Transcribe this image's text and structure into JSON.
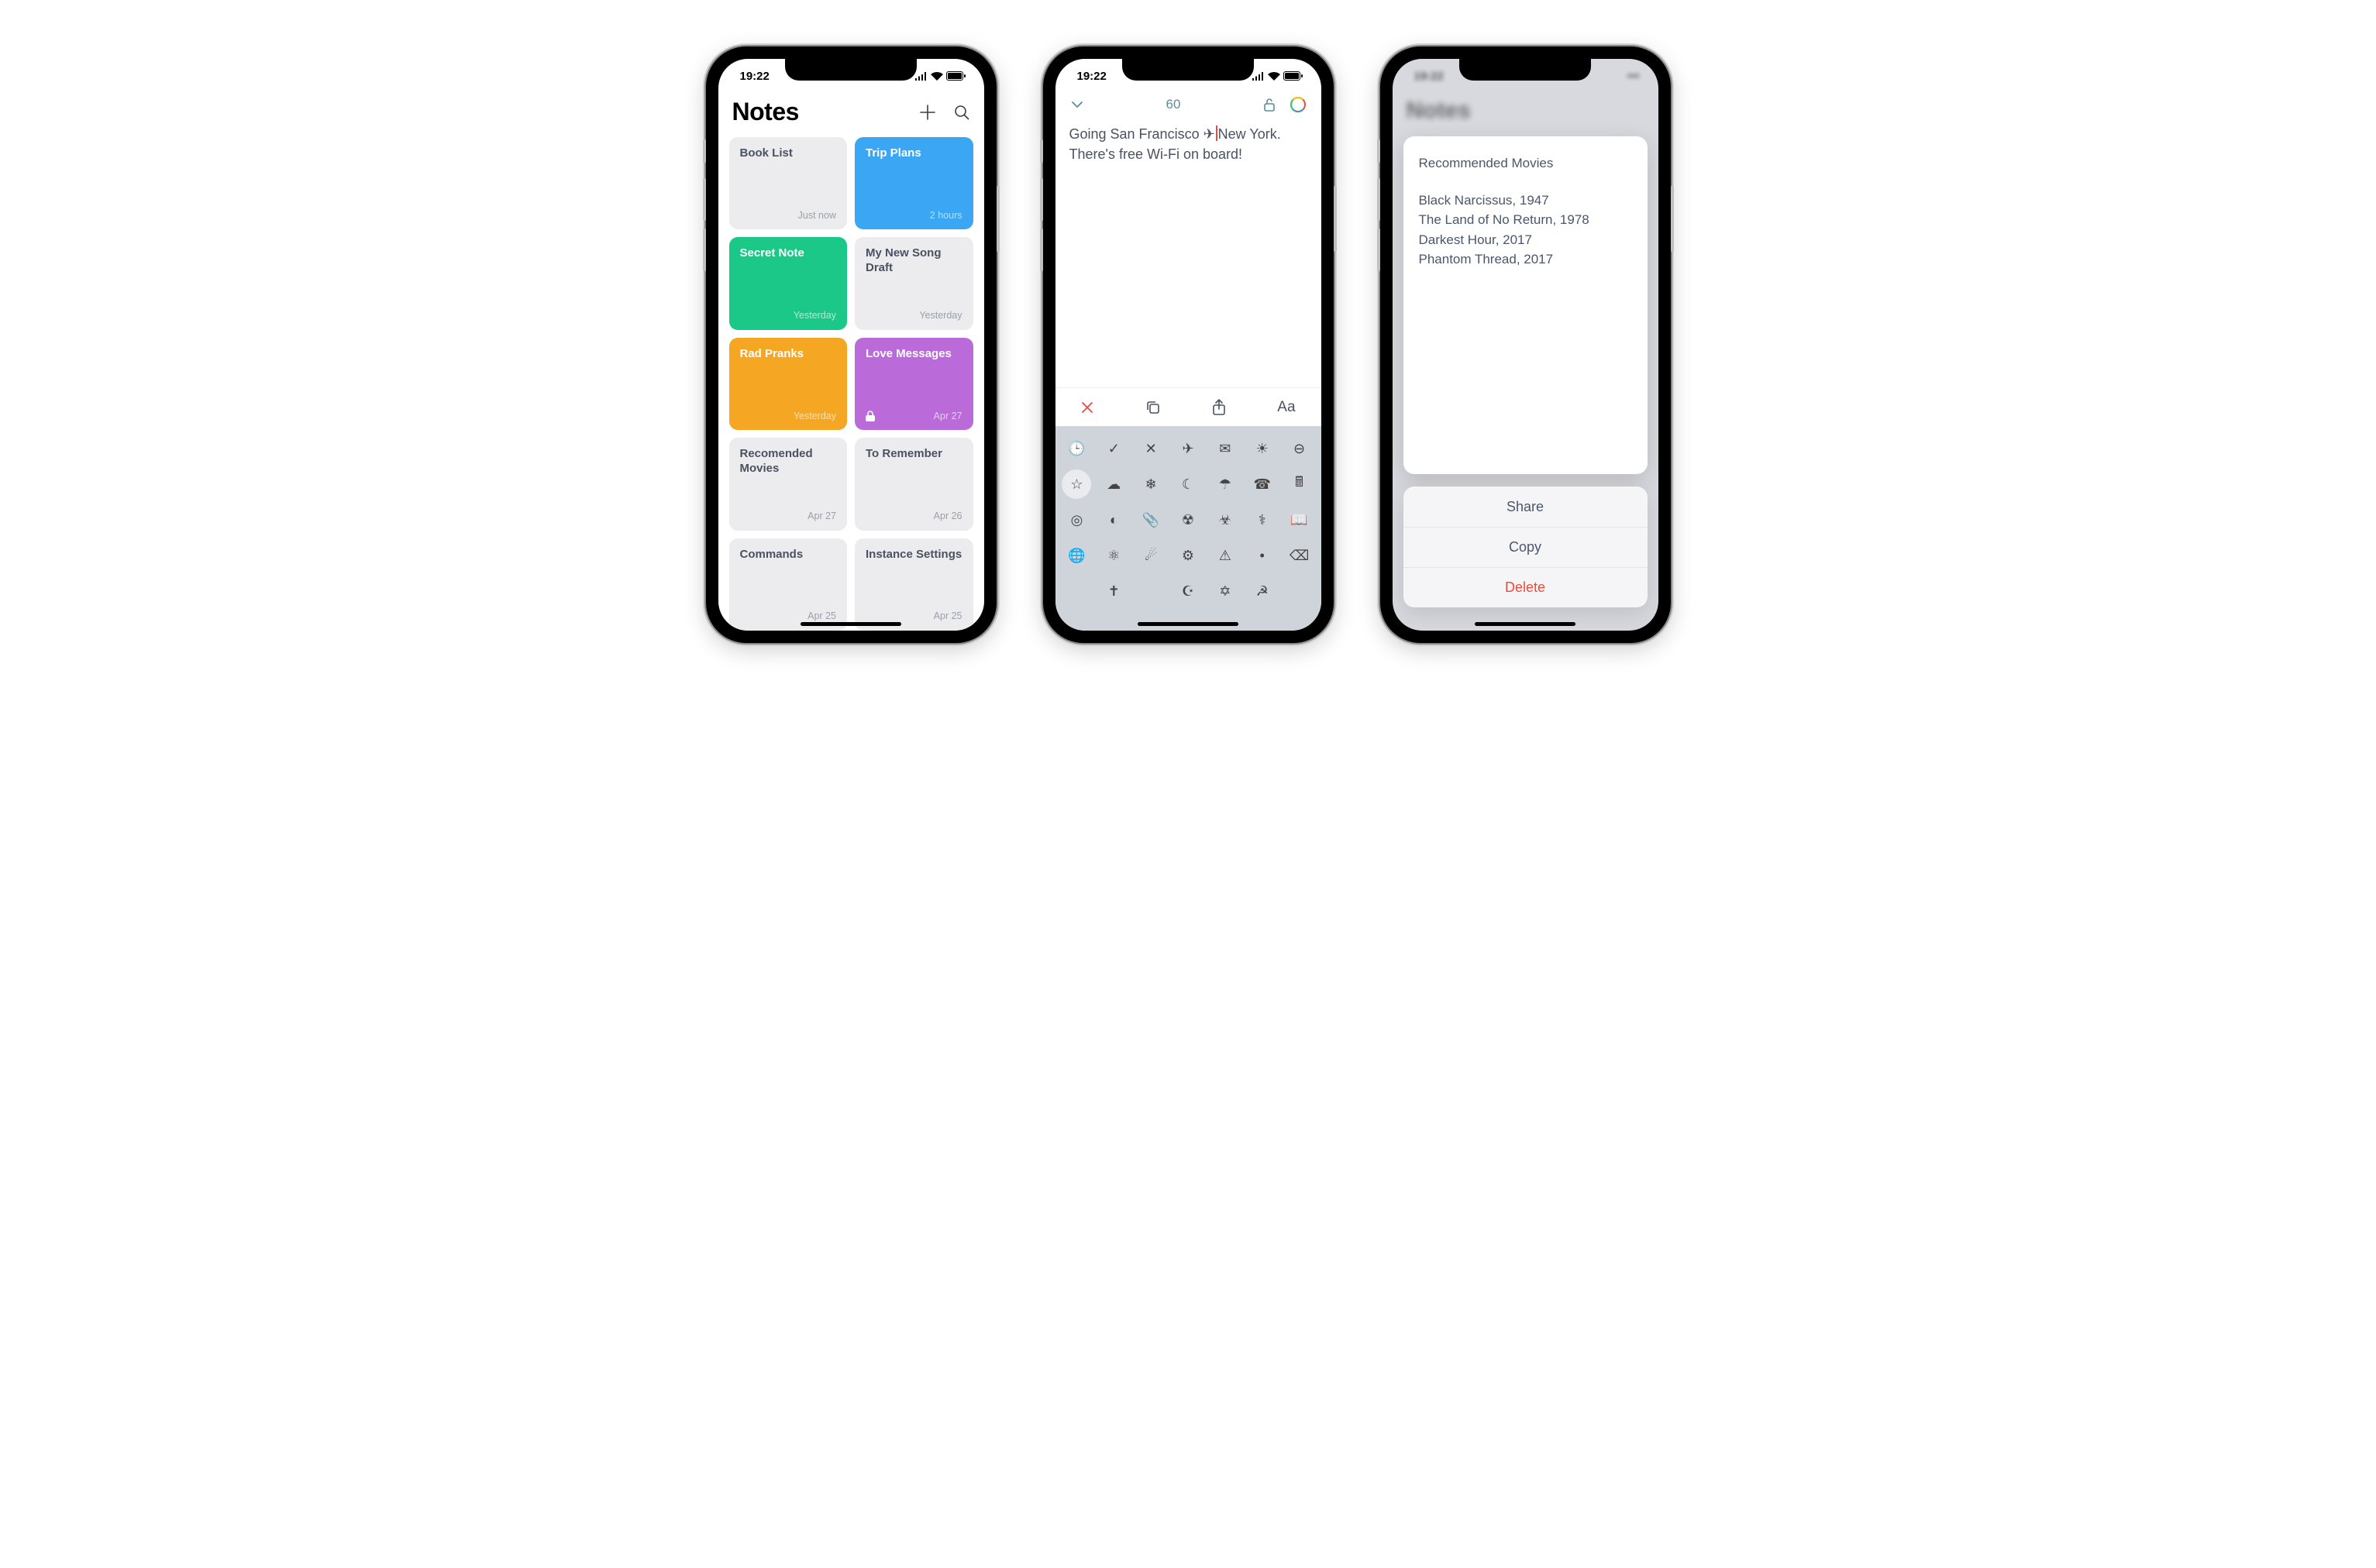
{
  "status_time": "19:22",
  "screen1": {
    "title": "Notes",
    "cards": [
      {
        "title": "Book List",
        "time": "Just now",
        "color": "gray"
      },
      {
        "title": "Trip Plans",
        "time": "2 hours",
        "color": "blue"
      },
      {
        "title": "Secret Note",
        "time": "Yesterday",
        "color": "green"
      },
      {
        "title": "My New Song Draft",
        "time": "Yesterday",
        "color": "gray"
      },
      {
        "title": "Rad Pranks",
        "time": "Yesterday",
        "color": "orange"
      },
      {
        "title": "Love Messages",
        "time": "Apr 27",
        "color": "purple",
        "locked": true
      },
      {
        "title": "Recomended Movies",
        "time": "Apr 27",
        "color": "gray"
      },
      {
        "title": "To Remember",
        "time": "Apr 26",
        "color": "gray"
      },
      {
        "title": "Commands",
        "time": "Apr 25",
        "color": "gray"
      },
      {
        "title": "Instance Settings",
        "time": "Apr 25",
        "color": "gray"
      }
    ]
  },
  "screen2": {
    "char_count": "60",
    "line1_a": "Going San Francisco ✈",
    "line1_b": "New York.",
    "line2": "There's free Wi-Fi on board!",
    "toolbar": {
      "close": "✕",
      "copy": "copy",
      "share": "share",
      "text": "Aa"
    },
    "emoji_rows": [
      [
        "🕒",
        "✓",
        "✕",
        "✈",
        "✉",
        "☀",
        "⊖"
      ],
      [
        "☆",
        "☁",
        "❄",
        "☾",
        "☂",
        "☎",
        "🖩"
      ],
      [
        "◎",
        "◐",
        "📎",
        "☢",
        "☣",
        "⚕",
        "📖"
      ],
      [
        "🌐",
        "⚛",
        "☄",
        "⚙",
        "⚠",
        "•",
        "⌫"
      ],
      [
        "",
        "✝",
        "",
        "☪",
        "✡",
        "☭",
        ""
      ]
    ]
  },
  "screen3": {
    "blur_title": "Notes",
    "preview_title": "Recommended Movies",
    "preview_lines": [
      "Black Narcissus, 1947",
      "The Land of No Return, 1978",
      "Darkest Hour, 2017",
      "Phantom Thread, 2017"
    ],
    "actions": {
      "share": "Share",
      "copy": "Copy",
      "delete": "Delete"
    }
  }
}
